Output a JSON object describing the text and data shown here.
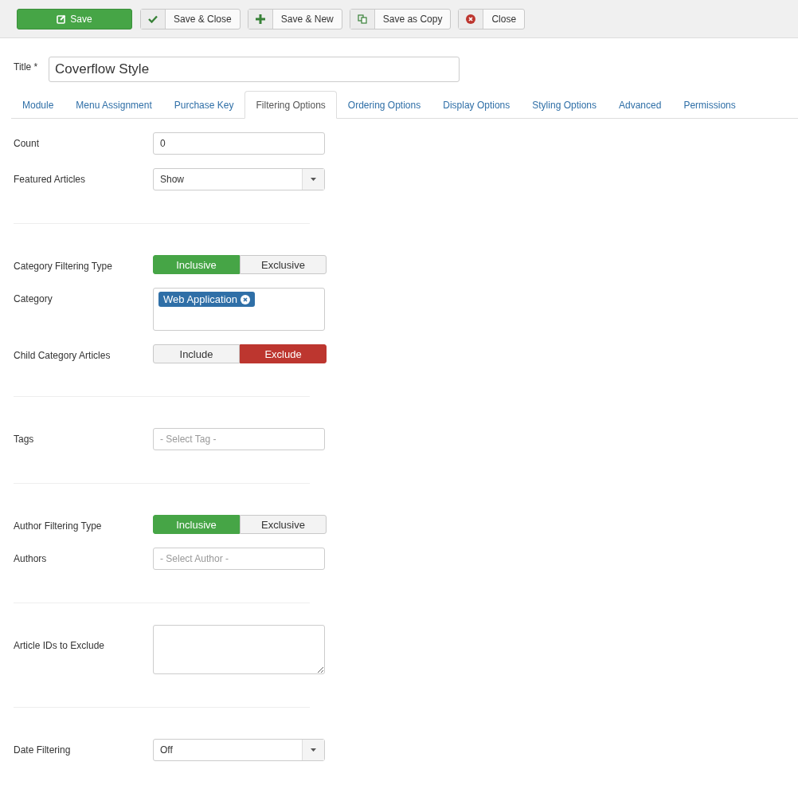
{
  "toolbar": [
    {
      "label": "Save",
      "kind": "primary"
    },
    {
      "label": "Save & Close",
      "kind": "check"
    },
    {
      "label": "Save & New",
      "kind": "plus"
    },
    {
      "label": "Save as Copy",
      "kind": "copy"
    },
    {
      "label": "Close",
      "kind": "close"
    }
  ],
  "title": {
    "label": "Title *",
    "value": "Coverflow Style"
  },
  "tabs": [
    {
      "label": "Module",
      "selected": false
    },
    {
      "label": "Menu Assignment",
      "selected": false
    },
    {
      "label": "Purchase Key",
      "selected": false
    },
    {
      "label": "Filtering Options",
      "selected": true
    },
    {
      "label": "Ordering Options",
      "selected": false
    },
    {
      "label": "Display Options",
      "selected": false
    },
    {
      "label": "Styling Options",
      "selected": false
    },
    {
      "label": "Advanced",
      "selected": false
    },
    {
      "label": "Permissions",
      "selected": false
    }
  ],
  "sections": [
    {
      "fields": [
        {
          "label": "Count",
          "kind": "text",
          "value": "0"
        },
        {
          "label": "Featured Articles",
          "kind": "select",
          "value": "Show"
        }
      ]
    },
    {
      "fields": [
        {
          "label": "Category Filtering Type",
          "kind": "toggle",
          "color": "#46a546",
          "options": [
            {
              "label": "Inclusive",
              "selected": true
            },
            {
              "label": "Exclusive",
              "selected": false
            }
          ]
        },
        {
          "label": "Category",
          "kind": "tags",
          "tags": [
            "Web Application"
          ]
        },
        {
          "label": "Child Category Articles",
          "kind": "toggle",
          "color": "#bd362f",
          "options": [
            {
              "label": "Include",
              "selected": false
            },
            {
              "label": "Exclude",
              "selected": true
            }
          ]
        }
      ]
    },
    {
      "fields": [
        {
          "label": "Tags",
          "kind": "text",
          "placeholder": "- Select Tag -"
        }
      ]
    },
    {
      "fields": [
        {
          "label": "Author Filtering Type",
          "kind": "toggle",
          "color": "#46a546",
          "options": [
            {
              "label": "Inclusive",
              "selected": true
            },
            {
              "label": "Exclusive",
              "selected": false
            }
          ]
        },
        {
          "label": "Authors",
          "kind": "text",
          "placeholder": "- Select Author -"
        }
      ]
    },
    {
      "fields": [
        {
          "label": "Article IDs to Exclude",
          "kind": "textarea"
        }
      ]
    },
    {
      "fields": [
        {
          "label": "Date Filtering",
          "kind": "select",
          "value": "Off"
        }
      ]
    }
  ]
}
